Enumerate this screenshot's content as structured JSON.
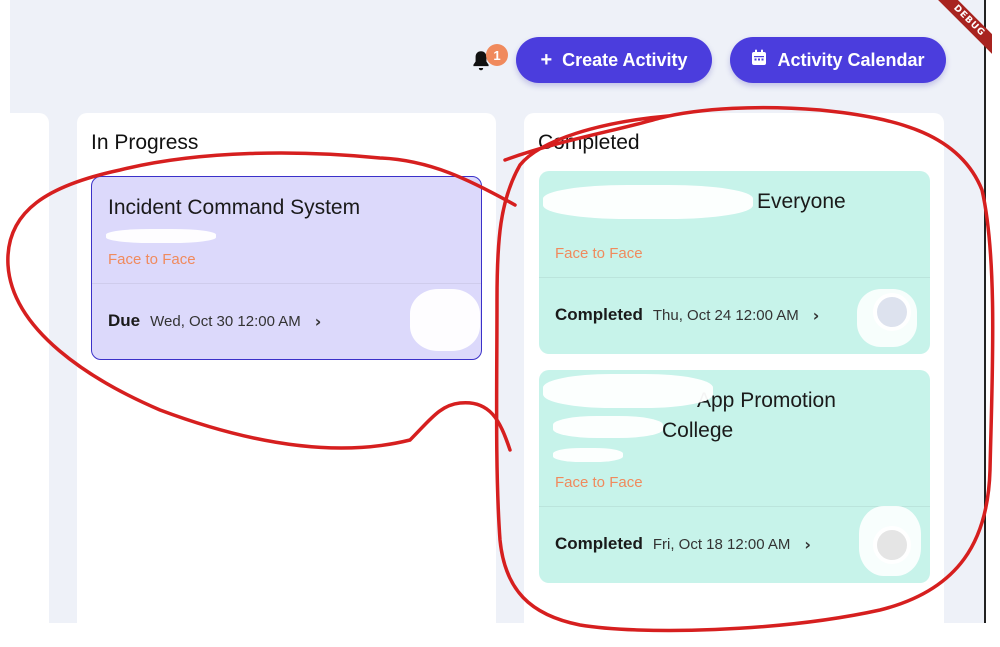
{
  "debug_banner": "DEBUG",
  "header": {
    "notification_count": "1",
    "create_button": "Create Activity",
    "create_button_icon": "+",
    "calendar_button": "Activity Calendar"
  },
  "columns": {
    "in_progress": {
      "title": "In Progress",
      "cards": [
        {
          "title": "Incident Command System",
          "mode": "Face to Face",
          "status_label": "Due",
          "date": "Wed, Oct 30 12:00 AM"
        }
      ]
    },
    "completed": {
      "title": "Completed",
      "cards": [
        {
          "title": "Everyone",
          "mode": "Face to Face",
          "status_label": "Completed",
          "date": "Thu, Oct 24 12:00 AM"
        },
        {
          "title": "App Promotion",
          "title_line2": "College",
          "mode": "Face to Face",
          "status_label": "Completed",
          "date": "Fri, Oct 18 12:00 AM"
        }
      ]
    }
  },
  "colors": {
    "primary": "#4b3ddd",
    "in_progress_card": "#dcd9fb",
    "completed_card": "#c7f3ea",
    "mode_text": "#f08a5d",
    "badge": "#f08a5d",
    "annotation": "#d61f1f"
  }
}
